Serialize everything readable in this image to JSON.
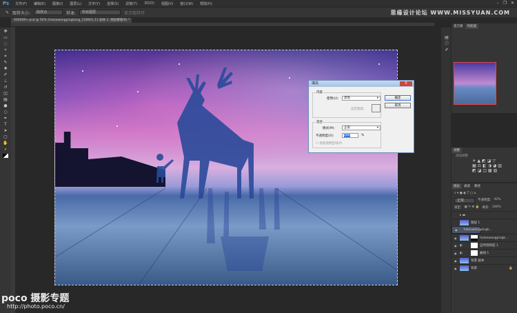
{
  "menubar": {
    "logo": "Ps",
    "items": [
      "文件(F)",
      "编辑(E)",
      "图像(I)",
      "图层(L)",
      "文字(Y)",
      "选择(S)",
      "滤镜(T)",
      "3D(D)",
      "视图(V)",
      "窗口(W)",
      "帮助(H)"
    ]
  },
  "options": {
    "size_label": "取样大小:",
    "size_value": "取样点",
    "sample_label": "样本:",
    "sample_value": "所有图层",
    "show_ring": "显示取样环"
  },
  "document_tab": "000009+.psd @ 50% (haloowangpingkong_126901,11 副本 2, 图层蒙版/8) *",
  "watermark_top": "思缘设计论坛 WWW.MISSYUAN.COM",
  "panels": {
    "nav_tabs": [
      "直方图",
      "导航器"
    ],
    "adj_title": "调整",
    "adj_sub": "添加调整",
    "layer_tabs": [
      "图层",
      "通道",
      "路径"
    ],
    "blend_mode": "正常",
    "opacity_label": "不透明度:",
    "opacity": "42%",
    "lock_label": "锁定:",
    "fill_label": "填充:",
    "fill": "100%",
    "layers": [
      {
        "name": "图层 1"
      },
      {
        "name": "haloowangpingk..."
      },
      {
        "name": "haloowangpingk..."
      },
      {
        "name": "自然饱和度 1"
      },
      {
        "name": "曲线 1"
      },
      {
        "name": "背景 副本"
      },
      {
        "name": "背景"
      }
    ]
  },
  "dialog": {
    "title": "填充",
    "close": "X",
    "content_group": "内容",
    "use_label": "使用(U):",
    "use_value": "黑色",
    "custom_pattern": "自定图案:",
    "blend_group": "混合",
    "mode_label": "模式(M):",
    "mode_value": "正常",
    "opacity_label": "不透明度(O):",
    "opacity_value": "100",
    "percent": "%",
    "preserve": "保留透明区域(P)",
    "ok": "确定",
    "cancel": "取消"
  },
  "watermark_bottom": {
    "brand": "poco 摄影专题",
    "url": "http://photo.poco.cn/"
  }
}
